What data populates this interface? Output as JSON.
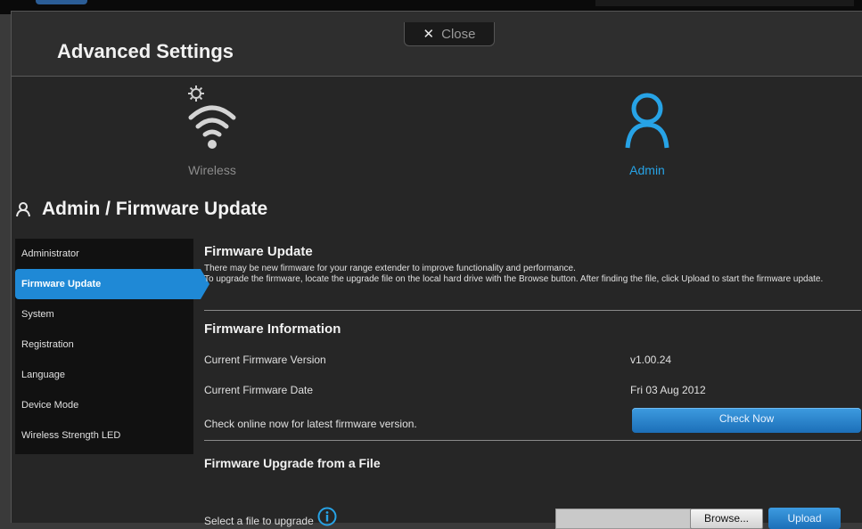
{
  "window": {
    "title": "Advanced Settings",
    "close_label": "Close"
  },
  "nav": [
    {
      "label": "Wireless",
      "icon": "wifi-gear-icon",
      "active": false
    },
    {
      "label": "Admin",
      "icon": "user-icon",
      "active": true
    }
  ],
  "section": {
    "title": "Admin / Firmware Update",
    "icon": "user-icon"
  },
  "sidebar": {
    "items": [
      {
        "label": "Administrator"
      },
      {
        "label": "Firmware Update"
      },
      {
        "label": "System"
      },
      {
        "label": "Registration"
      },
      {
        "label": "Language"
      },
      {
        "label": "Device Mode"
      },
      {
        "label": "Wireless Strength LED"
      }
    ]
  },
  "firmware_update": {
    "heading": "Firmware Update",
    "desc_1": "There may be new firmware for your range extender to improve functionality and performance.",
    "desc_2": "To upgrade the firmware, locate the upgrade file on the local hard drive with the Browse button. After finding the file, click Upload to start the firmware update."
  },
  "firmware_info": {
    "heading": "Firmware Information",
    "version_label": "Current Firmware Version",
    "version_value": "v1.00.24",
    "date_label": "Current Firmware Date",
    "date_value": "Fri 03 Aug 2012",
    "check_text": "Check online now for latest firmware version.",
    "check_button": "Check Now"
  },
  "upgrade": {
    "heading": "Firmware Upgrade from a File",
    "select_label": "Select a file to upgrade",
    "file_value": "",
    "browse_button": "Browse...",
    "upload_button": "Upload"
  },
  "colors": {
    "accent": "#1f89d6",
    "active_label": "#27a3e6",
    "panel_bg": "#262626"
  }
}
